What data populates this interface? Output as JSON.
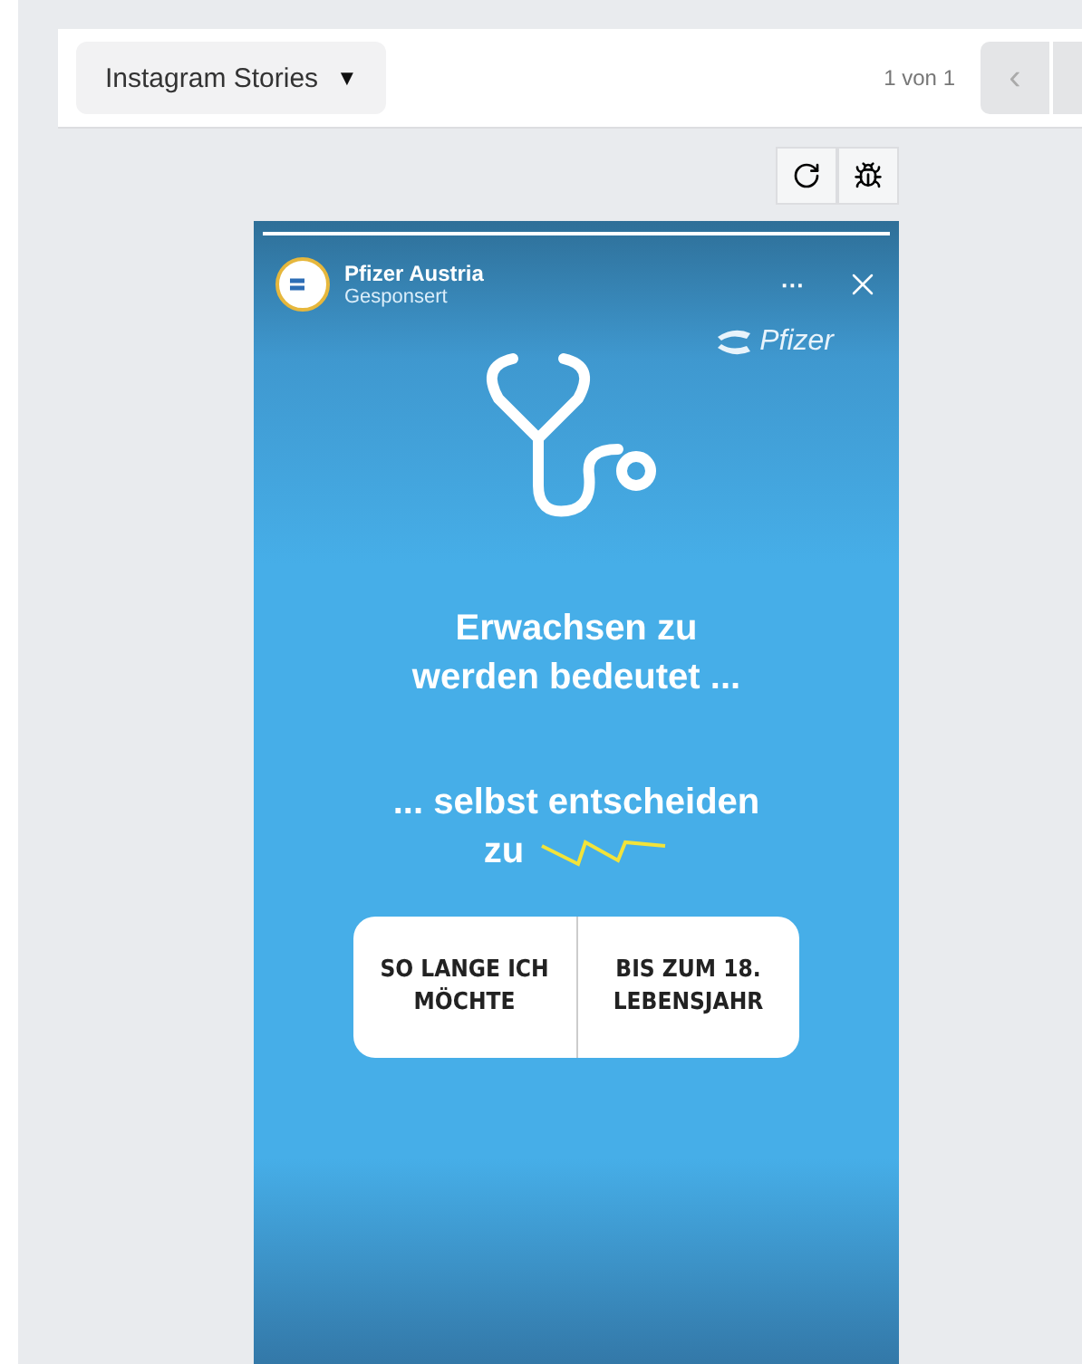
{
  "toolbar": {
    "format_select": {
      "label": "Instagram Stories",
      "caret": "▼"
    },
    "page_count": "1 von 1",
    "nav_buttons": [
      "‹"
    ]
  },
  "tools": [
    {
      "kind": "refresh"
    },
    {
      "kind": "bug"
    }
  ],
  "story": {
    "progress": {
      "level": 1
    },
    "account": "Pfizer Austria",
    "sponsored": "Gesponsert",
    "more": "···",
    "logo_text": "Pfizer",
    "headline": [
      "Erwachsen zu",
      "werden bedeutet ..."
    ],
    "subline": [
      "... selbst entscheiden",
      "zu"
    ],
    "poll": [
      {
        "label": "SO LANGE ICH MÖCHTE"
      },
      {
        "label": "BIS ZUM 18. LEBENSJAHR"
      }
    ]
  }
}
